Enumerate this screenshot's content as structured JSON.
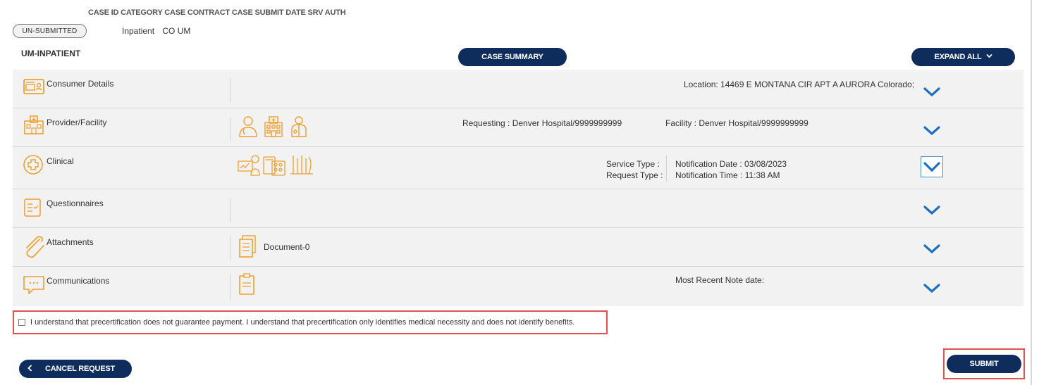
{
  "header": {
    "columns_text": "CASE ID CATEGORY CASE CONTRACT CASE SUBMIT DATE SRV AUTH",
    "status_badge": "UN-SUBMITTED",
    "category": "Inpatient",
    "contract": "CO UM",
    "section_title": "UM-INPATIENT",
    "case_summary_label": "CASE SUMMARY",
    "expand_all_label": "EXPAND ALL"
  },
  "rows": {
    "consumer": {
      "label": "Consumer Details",
      "location": "Location: 14469 E MONTANA CIR APT A AURORA Colorado;"
    },
    "provider": {
      "label": "Provider/Facility",
      "requesting": "Requesting : Denver Hospital/9999999999",
      "facility": "Facility : Denver Hospital/9999999999"
    },
    "clinical": {
      "label": "Clinical",
      "service_type": "Service Type :",
      "request_type": "Request Type :",
      "notification_date": "Notification Date : 03/08/2023",
      "notification_time": "Notification Time : 11:38 AM"
    },
    "questionnaires": {
      "label": "Questionnaires"
    },
    "attachments": {
      "label": "Attachments",
      "document": "Document-0"
    },
    "communications": {
      "label": "Communications",
      "recent_note": "Most Recent Note date:"
    }
  },
  "consent_text": "I understand that precertification does not guarantee payment. I understand that precertification only identifies medical necessity and does not identify benefits.",
  "footer": {
    "cancel_label": "CANCEL REQUEST",
    "submit_label": "SUBMIT"
  },
  "colors": {
    "accent_navy": "#0f2d5c",
    "icon_orange": "#f0a030",
    "chevron_blue": "#1f6fc4",
    "highlight_red": "#e05252"
  }
}
